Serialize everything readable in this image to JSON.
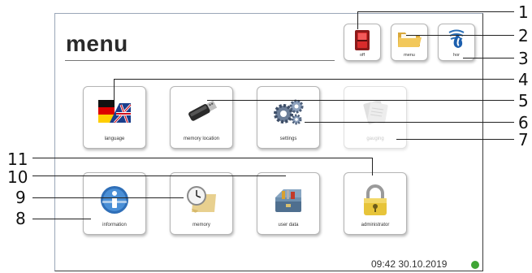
{
  "screen": {
    "title": "menu",
    "status_time": "09:42 30.10.2019",
    "status_indicator_color": "#3fa535"
  },
  "top_buttons": [
    {
      "label": "off",
      "icon": "power-switch-icon"
    },
    {
      "label": "menu",
      "icon": "folder-icon"
    },
    {
      "label": "hor",
      "icon": "water-drop-icon"
    }
  ],
  "tiles": [
    {
      "label": "language",
      "icon": "flag-icon",
      "enabled": true
    },
    {
      "label": "memory location",
      "icon": "usb-stick-icon",
      "enabled": true
    },
    {
      "label": "settings",
      "icon": "gears-icon",
      "enabled": true
    },
    {
      "label": "gauging",
      "icon": "gauging-icon",
      "enabled": false
    },
    {
      "label": "information",
      "icon": "info-icon",
      "enabled": true
    },
    {
      "label": "memory",
      "icon": "clock-scroll-icon",
      "enabled": true
    },
    {
      "label": "user data",
      "icon": "toolbox-icon",
      "enabled": true
    },
    {
      "label": "administrator",
      "icon": "padlock-icon",
      "enabled": true
    }
  ],
  "callouts": [
    "1",
    "2",
    "3",
    "4",
    "5",
    "6",
    "7",
    "8",
    "9",
    "10",
    "11"
  ]
}
